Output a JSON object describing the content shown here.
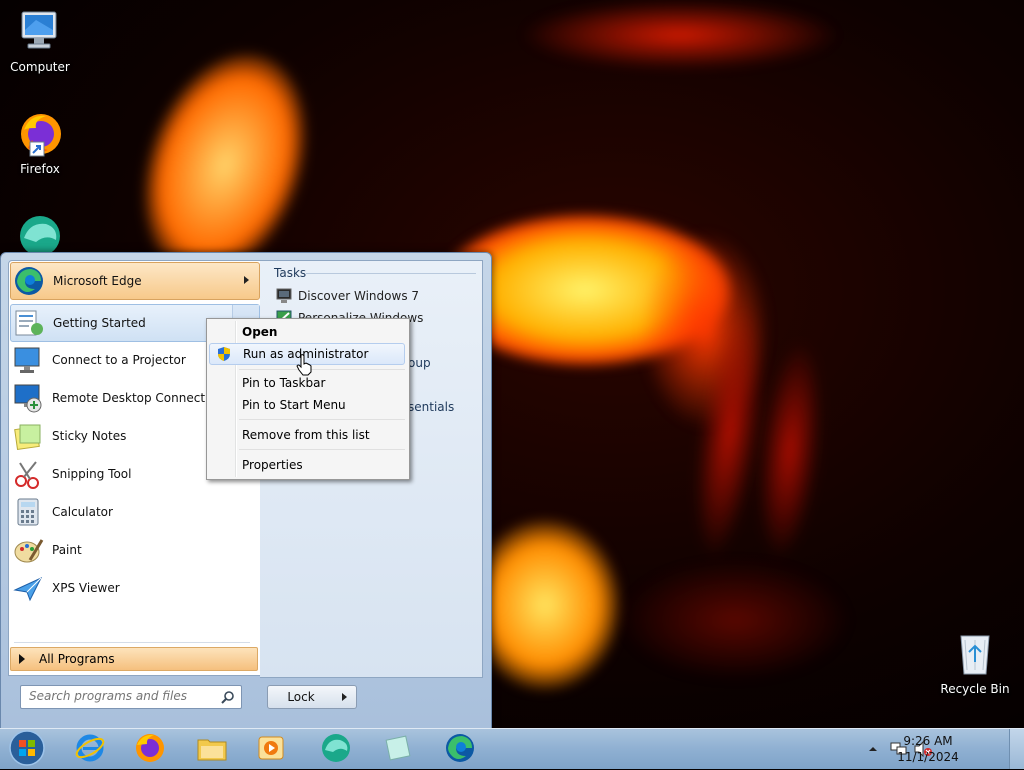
{
  "desktop": {
    "icons": [
      {
        "label": "Computer",
        "icon": "computer-icon"
      },
      {
        "label": "Firefox",
        "icon": "firefox-icon"
      },
      {
        "label": "",
        "icon": "app-icon"
      },
      {
        "label": "Recycle Bin",
        "icon": "recycle-bin-icon"
      }
    ]
  },
  "start_menu": {
    "programs": [
      {
        "label": "Microsoft Edge",
        "icon": "edge-icon"
      },
      {
        "label": "Getting Started",
        "icon": "getting-started-icon"
      },
      {
        "label": "Connect to a Projector",
        "icon": "projector-icon"
      },
      {
        "label": "Remote Desktop Connection",
        "icon": "remote-desktop-icon"
      },
      {
        "label": "Sticky Notes",
        "icon": "sticky-notes-icon"
      },
      {
        "label": "Snipping Tool",
        "icon": "snipping-tool-icon"
      },
      {
        "label": "Calculator",
        "icon": "calculator-icon"
      },
      {
        "label": "Paint",
        "icon": "paint-icon"
      },
      {
        "label": "XPS Viewer",
        "icon": "xps-viewer-icon"
      }
    ],
    "all_programs": "All Programs",
    "search_placeholder": "Search programs and files",
    "lock_label": "Lock",
    "tasks_header": "Tasks",
    "tasks": [
      {
        "label": "Discover Windows 7",
        "icon": "monitor-icon"
      },
      {
        "label": "Personalize Windows",
        "icon": "personalize-icon"
      }
    ],
    "partial_texts": [
      "oup",
      "s",
      "sentials"
    ]
  },
  "context_menu": {
    "items": [
      {
        "label": "Open",
        "bold": true
      },
      {
        "label": "Run as administrator",
        "icon": "uac-shield-icon",
        "highlighted": true
      },
      {
        "label": "Pin to Taskbar"
      },
      {
        "label": "Pin to Start Menu"
      },
      {
        "label": "Remove from this list"
      },
      {
        "label": "Properties"
      }
    ]
  },
  "taskbar": {
    "pinned": [
      "start-orb-icon",
      "internet-explorer-icon",
      "firefox-icon",
      "file-explorer-icon",
      "media-player-icon",
      "app-icon",
      "sticky-notes-icon",
      "edge-icon"
    ],
    "time": "9:26 AM",
    "date": "11/1/2024"
  },
  "colors": {
    "accent_orange": "#f7c98a",
    "taskbar_blue": "#8fb0d2",
    "edge_blue": "#0c59a4",
    "edge_green": "#3bbf6b"
  }
}
